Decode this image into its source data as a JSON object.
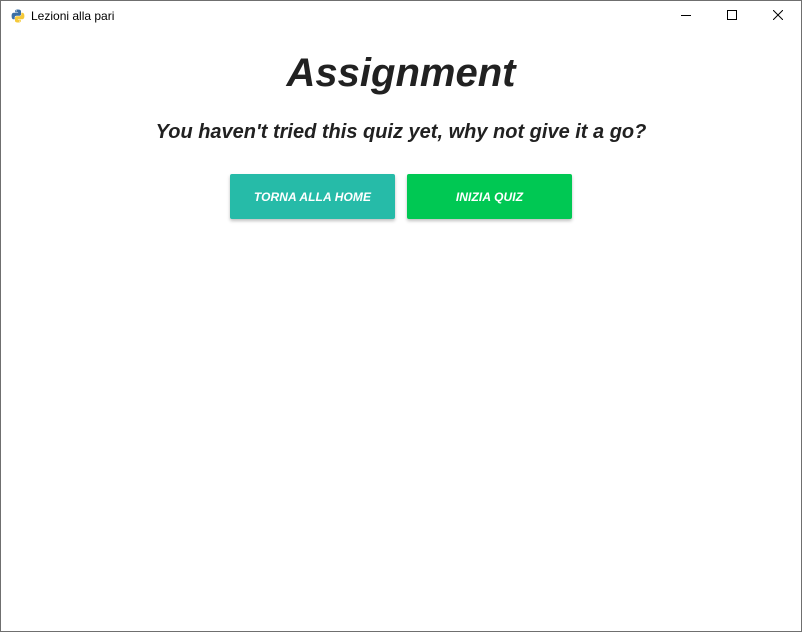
{
  "window": {
    "title": "Lezioni alla pari"
  },
  "page": {
    "heading": "Assignment",
    "message": "You haven't tried this quiz yet, why not give it a go?"
  },
  "actions": {
    "home_label": "TORNA ALLA HOME",
    "start_label": "INIZIA QUIZ"
  },
  "colors": {
    "home_button": "#26bba8",
    "start_button": "#00c853",
    "text": "#212121"
  },
  "icons": {
    "app": "python-icon",
    "minimize": "minimize-icon",
    "maximize": "maximize-icon",
    "close": "close-icon"
  }
}
